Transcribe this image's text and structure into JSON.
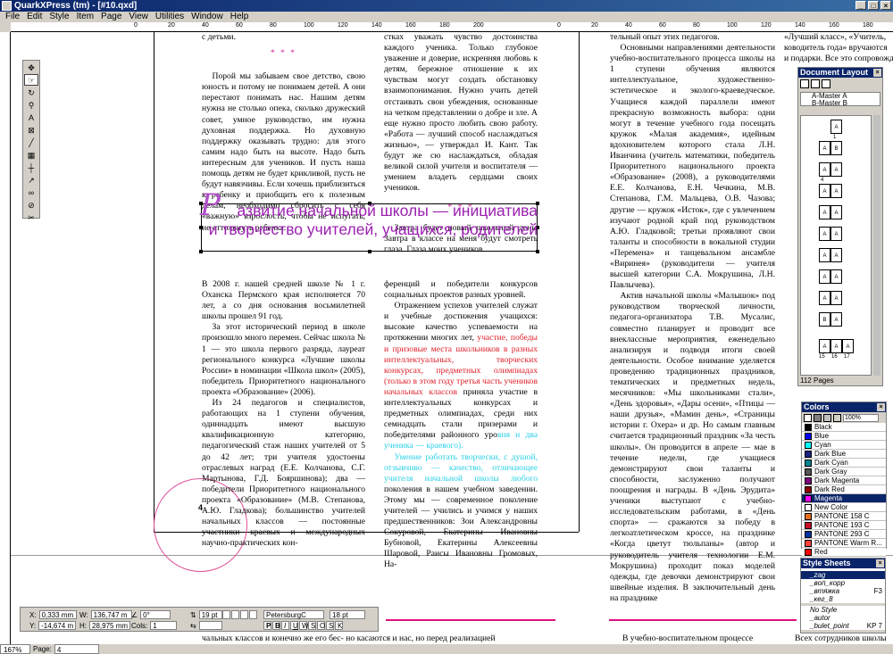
{
  "window": {
    "title": "QuarkXPress (tm) - [#10.qxd]",
    "buttons": [
      "_",
      "□",
      "×"
    ]
  },
  "menu": [
    "File",
    "Edit",
    "Style",
    "Item",
    "Page",
    "View",
    "Utilities",
    "Window",
    "Help"
  ],
  "hruler_labels": [
    "0",
    "20",
    "40",
    "60",
    "80",
    "100",
    "120",
    "140",
    "160",
    "180",
    "200",
    "0",
    "20",
    "40",
    "60",
    "80",
    "100",
    "120",
    "140",
    "160",
    "180",
    "200"
  ],
  "page_number": "4",
  "left_page": {
    "col1_top_lines": "с детьми.",
    "col1_stars": "* * *",
    "col1_p1": "Порой мы забываем свое детство, свою юность и потому не понимаем детей. А они перестают понимать нас. Нашим детям нужна не столько опека, сколько дружеский совет, умное руководство, им нужна духовная поддержка. Но духовную поддержку оказывать трудно: для этого самим надо быть на высоте. Надо быть интересным для учеников. И пусть наша помощь детям не будет крикливой, пусть не будут навязчивы. Если хочешь приблизиться к ребенку и приобщить его к полезным делам, необходимо сбросить с себя «важную» взрослость, чтобы не испугать, не оттолкнуть ребенка.",
    "col2_p1": "стках уважать чувство достоинства каждого ученика. Только глубокое уважение и доверие, искренняя любовь к детям, бережное отношение к их чувствам могут создать обстановку взаимопонимания. Нужно учить детей отстаивать свои убеждения, основанные на четком представлении о добре и зле. А еще нужно просто любить свою работу. «Работа — лучший способ наслаждаться жизнью», — утверждал И. Кант. Так будут же сю наслаждаться, обладая великой силой учителя и воспитателя — умением владеть сердцами своих учеников.",
    "col2_stars": "* * *",
    "col2_p2": "Завтра будет новый школьный день. Завтра в классе на меня будут смотреть глаза. Глаза моих учеников.",
    "headline_dropcap": "Р",
    "headline_line1": "азвитие начальной школы — инициатива",
    "headline_line2": "и творчество учителей, учащихся, родителей",
    "col1_art_p1": "В 2008 г. нашей средней школе № 1 г. Оханска Пермского края исполняется 70 лет, а со дня основания восьмилетней школы прошел 91 год.",
    "col1_art_p2": "За этот исторический период в школе произошло много перемен. Сейчас школа № 1 — это школа первого разряда, лауреат регионального конкурса «Лучшие школы России» в номинации «Школа школ» (2005), победитель Приоритетного национального проекта «Образование» (2006).",
    "col1_art_p3": "Из 24 педагогов и специалистов, работающих на 1 ступени обучения, одиннадцать имеют высшую квалификационную категорию, педагогический стаж наших учителей от 5 до 42 лет; три учителя удостоены отраслевых наград (Е.Е. Колчанова, С.Г. Мартынова, Г.Д. Бояршинова); два — победители Приоритетного национального проекта «Образование» (М.В. Степанова, А.Ю. Гладкова); большинство учителей начальных классов — постоянные участники краевых и международных научно-практических кон-",
    "col2_art_p1": "ференций и победители конкурсов социальных проектов разных уровней.",
    "col2_art_p2a": "Отражением успехов учителей служат и учебные достижения учащихся: высокие качество успеваемости на протяжении многих лет, ",
    "col2_art_p2red": "участие, победы и призовые места школьников в разных интеллектуальных, творческих конкурсах, предметных олимпиадах (только в этом году третья часть учеников начальных классов",
    "col2_art_p2b": " приняла участие в интеллектуальных конкурсах и предметных олимпиадах, среди них семнадцать стали призерами и победителями районного уро",
    "col2_art_p2cyan": "вня и два ученика — краевого).",
    "col2_art_p3cyan": "Умение работать творчески, с душой, отзывчиво — качество, отличающее учителя начальной школы любого",
    "col2_art_p3b": " поколения в нашем учебном заведении. Этому мы — современное поколение учителей — учились и учимся у наших предшественников: Зои Александровны Сокуровой, Екатерины Ивановны Бубновой, Екатерины Алексеевны Шаровой, Раисы Ивановны Громовых, На-",
    "bottom_line": "чальных классов и конечно же его бес-     но касаются и нас, но перед реализацией"
  },
  "right_page": {
    "col1_top": "тельный опыт этих педагогов.",
    "col1_p1": "Основными направлениями деятельности учебно-воспитательного процесса школы на 1 ступени обучения являются интеллектуальное, художественно-эстетическое и эколого-краеведческое. Учащиеся каждой параллели имеют прекрасную возможность выбора: одни могут в течение учебного года посещать кружок «Малая академия», идейным вдохновителем которого стала Л.Н. Иванчина (учитель математики, победитель Приоритетного национального проекта «Образование» (2008), а руководителями Е.Е. Колчанова, Е.Н. Чечкина, М.В. Степанова, Г.М. Мальцева, О.В. Чазова; другие — кружок «Исток», где с увлечением изучают родной край под руководством А.Ю. Гладковой; третьи проявляют свои таланты и способности в вокальной студии «Перемена» и танцевальном ансамбле «Виринея» (руководители — учителя высшей категории С.А. Мокрушина, Л.Н. Павлычева).",
    "col1_p2": "Актив начальной школы «Малышок» под руководством творческой личности, педагога-организатора Т.В. Мусалис, совместно планирует и проводит все внеклассные мероприятия, еженедельно анализируя и подводя итоги своей деятельности. Особое внимание уделяется проведению традиционных праздников, тематических и предметных недель, месячников: «Мы школьниками стали», «День здоровья», «Дары осени», «Птицы — наши друзья», «Мамин день», «Страницы истории г. Оxера» и др. Но самым главным считается традиционный праздник «За честь школы». Он проводится в апреле — мае в течение недели, где учащиеся демонстрируют свои таланты и способности, заслуженно получают поощрения и награды. В «День Эрудита» ученики выступают с учебно-исследовательским работами, в «День спорта» — сражаются за победу в легкоатлетическом кроссе, на празднике «Когда цветут тюльпаны» (автор и руководитель учителя технологии Е.М. Мокрушина) проходит показ моделей одежды, где девочки демонстрируют свои швейные изделия. В заключительный день на празднике",
    "col2_top1": "«Лучший класс», «Учитель,",
    "col2_top2": "ководитель года» вручаются",
    "col2_top3": "и подарки. Все это сопровождается",
    "bottom_left": "В учебно-воспитательном процессе",
    "bottom_right": "Всех сотрудников школы"
  },
  "tools": [
    "move",
    "content",
    "rotate",
    "zoom",
    "text-box",
    "picture-box",
    "line",
    "table",
    "orth-line",
    "line-text",
    "link",
    "unlink",
    "scissors"
  ],
  "document_layout": {
    "title": "Document Layout",
    "masters": [
      "A-Master A",
      "B-Master B"
    ],
    "page_count": "112 Pages",
    "page_labels": [
      "A",
      "B",
      "A",
      "A",
      "A",
      "A",
      "A",
      "A",
      "A",
      "A",
      "A",
      "A",
      "A",
      "A",
      "A",
      "A",
      "A",
      "B",
      "A",
      "A"
    ],
    "page_numbers": [
      "1",
      "4",
      "15",
      "16",
      "17"
    ]
  },
  "colors_panel": {
    "title": "Colors",
    "tint": "100%",
    "items": [
      {
        "name": "Black",
        "hex": "#000000"
      },
      {
        "name": "Blue",
        "hex": "#0000ff"
      },
      {
        "name": "Cyan",
        "hex": "#00ffff"
      },
      {
        "name": "Dark Blue",
        "hex": "#1a237e"
      },
      {
        "name": "Dark Cyan",
        "hex": "#00838f"
      },
      {
        "name": "Dark Gray",
        "hex": "#555555"
      },
      {
        "name": "Dark Magenta",
        "hex": "#800080"
      },
      {
        "name": "Dark Red",
        "hex": "#8b0000"
      },
      {
        "name": "Magenta",
        "hex": "#ff00ff"
      },
      {
        "name": "New Color",
        "hex": "#ffffff"
      },
      {
        "name": "PANTONE 158 C",
        "hex": "#e8701c"
      },
      {
        "name": "PANTONE 193 C",
        "hex": "#c8102e"
      },
      {
        "name": "PANTONE 293 C",
        "hex": "#0033a0"
      },
      {
        "name": "PANTONE Warm R...",
        "hex": "#f9423a"
      },
      {
        "name": "Red",
        "hex": "#ff0000"
      }
    ],
    "selected": "Magenta"
  },
  "style_sheets": {
    "title": "Style Sheets",
    "paragraph": [
      {
        "name": "_zag",
        "key": ""
      },
      {
        "name": "_вoп_корр",
        "key": ""
      },
      {
        "name": "_втяжка",
        "key": "F3"
      },
      {
        "name": "_кег_8",
        "key": ""
      }
    ],
    "character": [
      {
        "name": "No Style",
        "key": ""
      },
      {
        "name": "_autor",
        "key": ""
      },
      {
        "name": "_bulet_point",
        "key": "KP 7"
      }
    ]
  },
  "measurements": {
    "x_label": "X:",
    "x_val": "0,333 mm",
    "y_label": "Y:",
    "y_val": "-14,674 m",
    "w_label": "W:",
    "w_val": "136,747 m",
    "h_label": "H:",
    "h_val": "28,975 mm",
    "angle_val": "0°",
    "cols_label": "Cols:",
    "cols_val": "1",
    "leading_val": "19 pt",
    "font_val": "PetersburgC",
    "size_val": "18 pt"
  },
  "status": {
    "zoom": "167%",
    "page_label": "Page:",
    "page_val": "4"
  }
}
